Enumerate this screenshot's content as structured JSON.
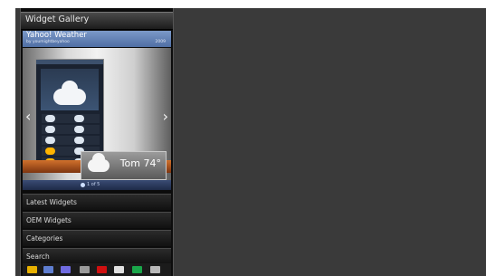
{
  "app": {
    "title": "Widget Gallery"
  },
  "featured": {
    "name": "Yahoo! Weather",
    "author": "by youmightbeyahoo",
    "date": "2009"
  },
  "preview": {
    "floating_temp": "Tom 74°",
    "page_label": "1 of 5"
  },
  "menu": [
    "Latest Widgets",
    "OEM Widgets",
    "Categories",
    "Search"
  ],
  "toolbar": {
    "icons": [
      {
        "name": "folder-icon",
        "color": "#e8b100"
      },
      {
        "name": "album-icon",
        "color": "#5f7ed0"
      },
      {
        "name": "photo-icon",
        "color": "#6f6be0"
      },
      {
        "name": "back-icon",
        "color": "#9a9a9a"
      },
      {
        "name": "record-icon",
        "color": "#d01010"
      },
      {
        "name": "plus-icon",
        "color": "#e0e0e0"
      },
      {
        "name": "green-icon",
        "color": "#1aa64a"
      },
      {
        "name": "grey-icon",
        "color": "#b8b8b8"
      }
    ]
  }
}
